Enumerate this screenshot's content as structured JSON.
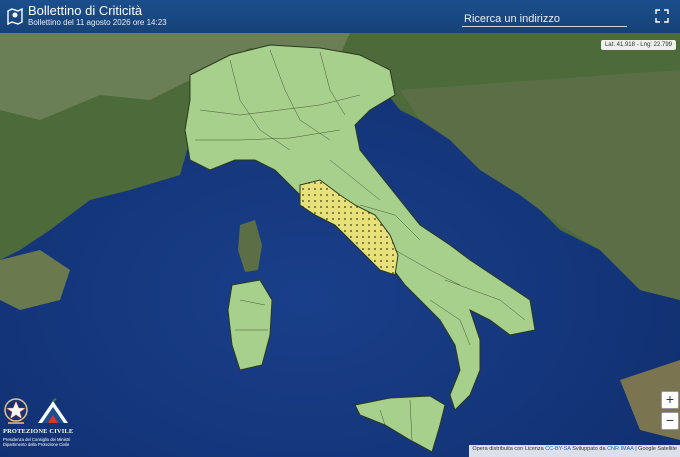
{
  "header": {
    "title": "Bollettino di Criticità",
    "subtitle": "Bollettino del 11 agosto 2026 ore 14:23",
    "search_placeholder": "Ricerca un indirizzo",
    "map_pin_icon": "map-pin-icon",
    "fullscreen_icon": "fullscreen-icon"
  },
  "map": {
    "coords": "Lat: 41.918 - Lng: 22.799",
    "zoom_in": "+",
    "zoom_out": "−",
    "legend_colors": {
      "green": "#a8d08d",
      "yellow": "#e8e07a",
      "sea": "#1e4a96"
    }
  },
  "attribution": {
    "prefix": "Opera distribuita con Licenza",
    "license": "CC-BY-SA",
    "dev_prefix": "Sviluppato da",
    "developer": "CNR IMAA",
    "source": "| Google Satellite"
  },
  "logo": {
    "title": "PROTEZIONE CIVILE",
    "line1": "Presidenza del Consiglio dei Ministri",
    "line2": "Dipartimento della Protezione Civile"
  }
}
